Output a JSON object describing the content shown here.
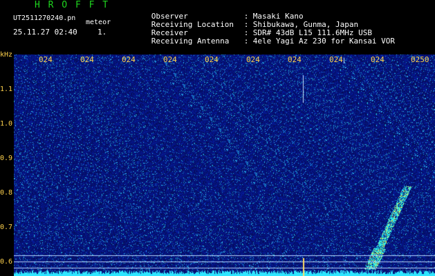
{
  "header": {
    "title": "H R O F F T",
    "filename": "UT2511270240.pn",
    "meteor": "meteor",
    "date_time": "25.11.27 02:40",
    "index": "1.",
    "meta": [
      {
        "label": "Observer",
        "sep": ":",
        "value": "Masaki Kano"
      },
      {
        "label": "Receiving Location",
        "sep": ":",
        "value": "Shibukawa, Gunma, Japan"
      },
      {
        "label": "Receiver",
        "sep": ":",
        "value": "SDR# 43dB L15 111.6MHz USB"
      },
      {
        "label": "Receiving Antenna",
        "sep": ":",
        "value": "4ele Yagi Az 230 for Kansai VOR"
      }
    ]
  },
  "axis": {
    "unit": "kHz",
    "y_ticks": [
      "1.1",
      "1.0",
      "0.9",
      "0.8",
      "0.7",
      "0.6"
    ],
    "x_ticks": [
      "024",
      "024",
      "024",
      "024",
      "024",
      "024",
      "024",
      "024",
      "024",
      "0250"
    ]
  },
  "colors": {
    "background": "#000000",
    "title": "#1fd61f",
    "axis_text": "#ffd24d",
    "noise_base": "#0a1a8c",
    "signal": "#38e8ff"
  }
}
